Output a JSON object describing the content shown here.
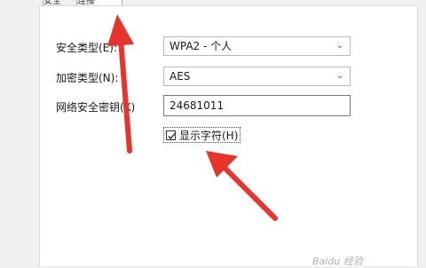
{
  "tabs": [
    {
      "label": "安全"
    },
    {
      "label": "连接"
    }
  ],
  "form": {
    "security_type": {
      "label": "安全类型(E):",
      "value": "WPA2 - 个人"
    },
    "encryption_type": {
      "label": "加密类型(N):",
      "value": "AES"
    },
    "network_key": {
      "label": "网络安全密钥(K)",
      "value": "24681011"
    },
    "show_chars": {
      "label": "显示字符(H)",
      "checked": true
    }
  },
  "annotations": {
    "arrow_color": "#e8342a"
  },
  "watermark": "Baidu 经验"
}
